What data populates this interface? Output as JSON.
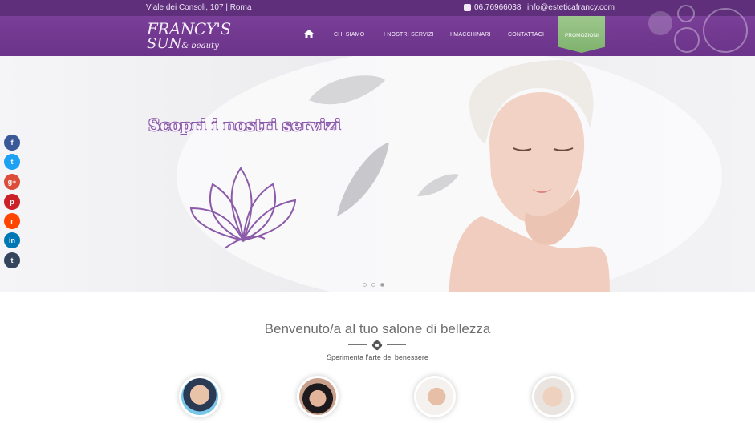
{
  "topbar": {
    "address": "Viale dei Consoli, 107 | Roma",
    "phone": "06.76966038",
    "email": "info@esteticafrancy.com"
  },
  "logo": {
    "line1": "FRANCY'S",
    "line2": "SUN",
    "line3": "& beauty"
  },
  "nav": {
    "items": [
      {
        "label": "CHI SIAMO"
      },
      {
        "label": "I NOSTRI SERVIZI"
      },
      {
        "label": "I MACCHINARI"
      },
      {
        "label": "CONTATTACI"
      }
    ],
    "promo_label": "PROMOZIONI"
  },
  "hero": {
    "title": "Scopri i nostri servizi"
  },
  "social": [
    {
      "icon": "facebook-icon",
      "glyph": "f",
      "color": "#3b5998"
    },
    {
      "icon": "twitter-icon",
      "glyph": "t",
      "color": "#1da1f2"
    },
    {
      "icon": "google-plus-icon",
      "glyph": "g+",
      "color": "#dd4b39"
    },
    {
      "icon": "pinterest-icon",
      "glyph": "p",
      "color": "#cb2027"
    },
    {
      "icon": "reddit-icon",
      "glyph": "r",
      "color": "#ff4500"
    },
    {
      "icon": "linkedin-icon",
      "glyph": "in",
      "color": "#0077b5"
    },
    {
      "icon": "tumblr-icon",
      "glyph": "t",
      "color": "#35465c"
    }
  ],
  "welcome": {
    "title": "Benvenuto/a al tuo salone di bellezza",
    "subtitle": "Sperimenta l'arte del benessere"
  },
  "colors": {
    "brand_purple": "#6b3389",
    "promo_green": "#86b874"
  }
}
